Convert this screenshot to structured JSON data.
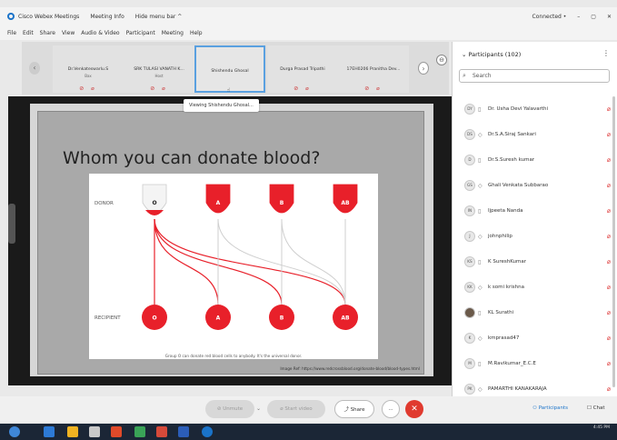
{
  "titlebar": {
    "app_name": "Cisco Webex Meetings",
    "meeting_info": "Meeting Info",
    "hide_menu": "Hide menu bar ^",
    "connection": "Connected •",
    "minimize": "–",
    "restore": "▢",
    "close": "✕"
  },
  "menubar": [
    "File",
    "Edit",
    "Share",
    "View",
    "Audio & Video",
    "Participant",
    "Meeting",
    "Help"
  ],
  "strip": {
    "tiles": [
      {
        "name": "Dr.Venkateswarlu.S",
        "sub": "Bax"
      },
      {
        "name": "SRK TULASI VANATH K...",
        "sub": "Host"
      },
      {
        "name": "Shishendu Ghosal",
        "sub": ""
      },
      {
        "name": "Durga Prasad Tripathi",
        "sub": ""
      },
      {
        "name": "17EH0206 Pranitha Dev...",
        "sub": ""
      }
    ],
    "next": "›",
    "prev": "‹"
  },
  "viewing_label": "Viewing Shishendu Ghosal...",
  "slide": {
    "title": "Whom you can donate blood?",
    "caption": "Group O can donate red blood cells to anybody. It's the universal donor.",
    "image_ref": "Image Ref: https://www.redcrossblood.org/donate-blood/blood-types.html"
  },
  "chart_data": {
    "type": "diagram",
    "donor_label": "DONOR",
    "recipient_label": "RECIPIENT",
    "donors": [
      "O",
      "A",
      "B",
      "AB"
    ],
    "recipients": [
      "O",
      "A",
      "B",
      "AB"
    ],
    "links": [
      [
        "O",
        "O"
      ],
      [
        "O",
        "A"
      ],
      [
        "O",
        "B"
      ],
      [
        "O",
        "AB"
      ],
      [
        "A",
        "A"
      ],
      [
        "A",
        "AB"
      ],
      [
        "B",
        "B"
      ],
      [
        "B",
        "AB"
      ],
      [
        "AB",
        "AB"
      ]
    ],
    "highlight_donor": "O",
    "colors": {
      "blood": "#e8202a",
      "line_highlight": "#e8202a",
      "line_muted": "#cfcfcf"
    }
  },
  "panel": {
    "title": "Participants (102)",
    "search_placeholder": "Search",
    "participants": [
      {
        "initials": "DY",
        "name": "Dr. Usha Devi Yalavarthi"
      },
      {
        "initials": "DS",
        "name": "Dr.S.A.Siraj Sankari"
      },
      {
        "initials": "D",
        "name": "Dr.S.Suresh kumar"
      },
      {
        "initials": "GS",
        "name": "Ghali Venkata Subbarao"
      },
      {
        "initials": "IN",
        "name": "Ijpeeta Nanda"
      },
      {
        "initials": "J",
        "name": "johnphilip"
      },
      {
        "initials": "KS",
        "name": "K SureshKumar"
      },
      {
        "initials": "KK",
        "name": "k somi krishna"
      },
      {
        "initials": "",
        "name": "KL Surathi"
      },
      {
        "initials": "K",
        "name": "kmprasad47"
      },
      {
        "initials": "M",
        "name": "M.Ravikumar_E.C.E"
      },
      {
        "initials": "PK",
        "name": "PAMARTHI KANAKARAJA"
      }
    ]
  },
  "controls": {
    "unmute": "Unmute",
    "start_video": "Start video",
    "share": "Share",
    "more": "···",
    "end": "✕",
    "participants": "Participants",
    "chat": "Chat"
  },
  "taskbar": {
    "time": "4:45 PM"
  }
}
